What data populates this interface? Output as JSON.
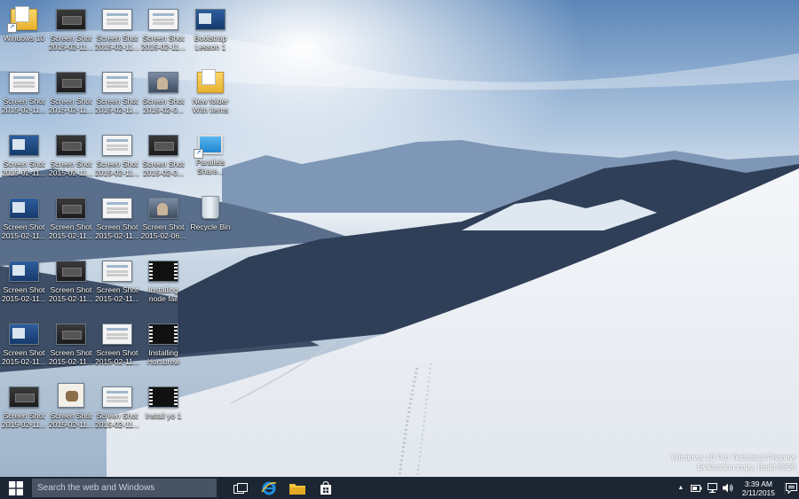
{
  "desktop": {
    "icons": [
      {
        "line1": "Windows 10",
        "line2": "",
        "type": "folder",
        "shortcut": true
      },
      {
        "line1": "Screen Shot",
        "line2": "2015-02-11...",
        "type": "dark"
      },
      {
        "line1": "Screen Shot",
        "line2": "2015-02-11...",
        "type": "light"
      },
      {
        "line1": "Screen Shot",
        "line2": "2015-02-11...",
        "type": "light"
      },
      {
        "line1": "Bootstrap",
        "line2": "Lesson 1",
        "type": "blue"
      },
      {
        "line1": "Screen Shot",
        "line2": "2015-02-11...",
        "type": "light"
      },
      {
        "line1": "Screen Shot",
        "line2": "2015-02-11...",
        "type": "dark"
      },
      {
        "line1": "Screen Shot",
        "line2": "2015-02-11...",
        "type": "light"
      },
      {
        "line1": "Screen Shot",
        "line2": "2015-02-0...",
        "type": "photo"
      },
      {
        "line1": "New folder",
        "line2": "With Items",
        "type": "folder"
      },
      {
        "line1": "Screen Shot",
        "line2": "2015-02-11...",
        "type": "blue"
      },
      {
        "line1": "Screen Shot",
        "line2": "2015-02-11...",
        "type": "dark"
      },
      {
        "line1": "Screen Shot",
        "line2": "2015-02-11...",
        "type": "light"
      },
      {
        "line1": "Screen Shot",
        "line2": "2015-02-0...",
        "type": "dark"
      },
      {
        "line1": "Parallels",
        "line2": "Share...",
        "type": "monitor",
        "shortcut": true
      },
      {
        "line1": "Screen Shot",
        "line2": "2015-02-11...",
        "type": "blue"
      },
      {
        "line1": "Screen Shot",
        "line2": "2015-02-11...",
        "type": "dark"
      },
      {
        "line1": "Screen Shot",
        "line2": "2015-02-11...",
        "type": "light"
      },
      {
        "line1": "Screen Shot",
        "line2": "2015-02-06...",
        "type": "photo"
      },
      {
        "line1": "Recycle Bin",
        "line2": "",
        "type": "bin"
      },
      {
        "line1": "Screen Shot",
        "line2": "2015-02-11...",
        "type": "blue"
      },
      {
        "line1": "Screen Shot",
        "line2": "2015-02-11...",
        "type": "dark"
      },
      {
        "line1": "Screen Shot",
        "line2": "2015-02-11...",
        "type": "light"
      },
      {
        "line1": "Installing",
        "line2": "node fail",
        "type": "term"
      },
      {
        "line1": "Screen Shot",
        "line2": "2015-02-11...",
        "type": "blue"
      },
      {
        "line1": "Screen Shot",
        "line2": "2015-02-11...",
        "type": "dark"
      },
      {
        "line1": "Screen Shot",
        "line2": "2015-02-11...",
        "type": "light"
      },
      {
        "line1": "Installing",
        "line2": "Hombrew",
        "type": "term"
      },
      {
        "line1": "Screen Shot",
        "line2": "2015-02-11...",
        "type": "dark"
      },
      {
        "line1": "Screen Shot",
        "line2": "2015-02-11...",
        "type": "cert"
      },
      {
        "line1": "Screen Shot",
        "line2": "2015-02-11...",
        "type": "light"
      },
      {
        "line1": "Install yo 1",
        "line2": "",
        "type": "term"
      }
    ]
  },
  "watermark": {
    "line1": "Windows 10 Pro Technical Preview",
    "line2": "Evaluation copy. Build 9926"
  },
  "taskbar": {
    "search_placeholder": "Search the web and Windows",
    "clock_time": "3:39 AM",
    "clock_date": "2/11/2015",
    "tray_expand_glyph": "▲"
  },
  "colors": {
    "taskbar_bg": "#1c2633",
    "search_bg": "#485463",
    "ie_blue": "#1e8fe0",
    "folder_yellow": "#f3c33b"
  }
}
